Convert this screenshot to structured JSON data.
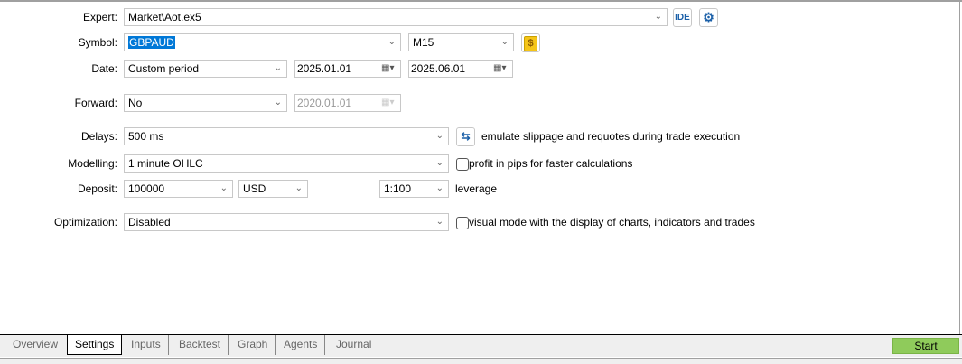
{
  "labels": {
    "expert": "Expert:",
    "symbol": "Symbol:",
    "date": "Date:",
    "forward": "Forward:",
    "delays": "Delays:",
    "modelling": "Modelling:",
    "deposit": "Deposit:",
    "optimization": "Optimization:"
  },
  "expert": {
    "value": "Market\\Aot.ex5",
    "ide_label": "IDE"
  },
  "symbol": {
    "value": "GBPAUD",
    "timeframe": "M15",
    "currency_icon": "$"
  },
  "date": {
    "mode": "Custom period",
    "from": "2025.01.01",
    "to": "2025.06.01"
  },
  "forward": {
    "mode": "No",
    "date": "2020.01.01"
  },
  "delays": {
    "value": "500 ms",
    "description": "emulate slippage and requotes during trade execution"
  },
  "modelling": {
    "value": "1 minute OHLC",
    "checkbox_label": "profit in pips for faster calculations",
    "checked": false
  },
  "deposit": {
    "amount": "100000",
    "currency": "USD",
    "leverage": "1:100",
    "leverage_label": "leverage"
  },
  "optimization": {
    "value": "Disabled",
    "checkbox_label": "visual mode with the display of charts, indicators and trades",
    "checked": false
  },
  "tabs": [
    "Overview",
    "Settings",
    "Inputs",
    "Backtest",
    "Graph",
    "Agents",
    "Journal"
  ],
  "active_tab": "Settings",
  "start_label": "Start"
}
